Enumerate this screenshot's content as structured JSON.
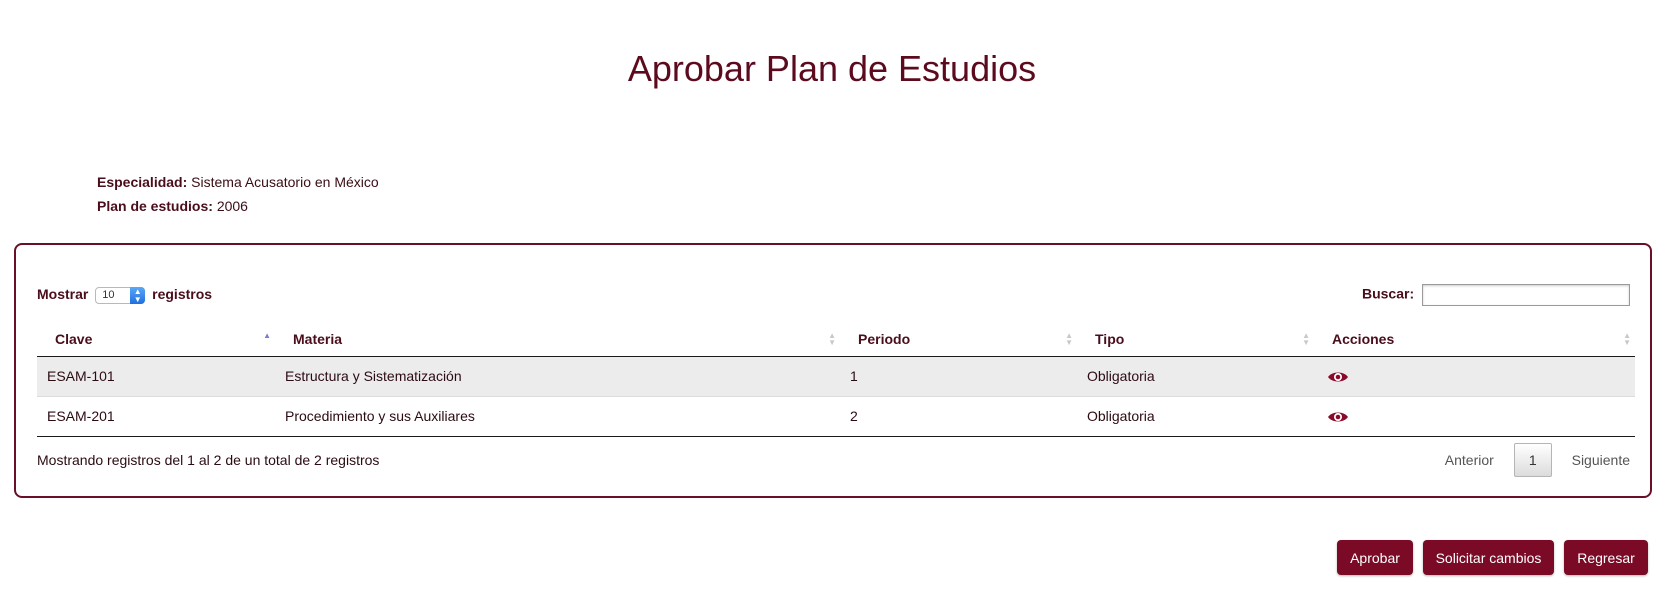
{
  "page": {
    "title": "Aprobar Plan de Estudios"
  },
  "info": {
    "especialidad_label": "Especialidad:",
    "especialidad_value": "Sistema Acusatorio en México",
    "plan_label": "Plan de estudios:",
    "plan_value": "2006"
  },
  "table_controls": {
    "mostrar_label": "Mostrar",
    "page_size": "10",
    "registros_label": "registros",
    "buscar_label": "Buscar:",
    "buscar_value": ""
  },
  "table": {
    "columns": [
      "Clave",
      "Materia",
      "Periodo",
      "Tipo",
      "Acciones"
    ],
    "rows": [
      {
        "clave": "ESAM-101",
        "materia": "Estructura y Sistematización",
        "periodo": "1",
        "tipo": "Obligatoria",
        "accion_icon": "eye-icon"
      },
      {
        "clave": "ESAM-201",
        "materia": "Procedimiento y sus Auxiliares",
        "periodo": "2",
        "tipo": "Obligatoria",
        "accion_icon": "eye-icon"
      }
    ]
  },
  "footer": {
    "info_text": "Mostrando registros del 1 al 2 de un total de 2 registros",
    "prev_label": "Anterior",
    "current_page": "1",
    "next_label": "Siguiente"
  },
  "actions": {
    "aprobar": "Aprobar",
    "solicitar": "Solicitar cambios",
    "regresar": "Regresar"
  },
  "colors": {
    "brand": "#7a0a26",
    "title": "#5c0a1e",
    "panel_border": "#6a1026",
    "row_alt": "#ececec"
  }
}
